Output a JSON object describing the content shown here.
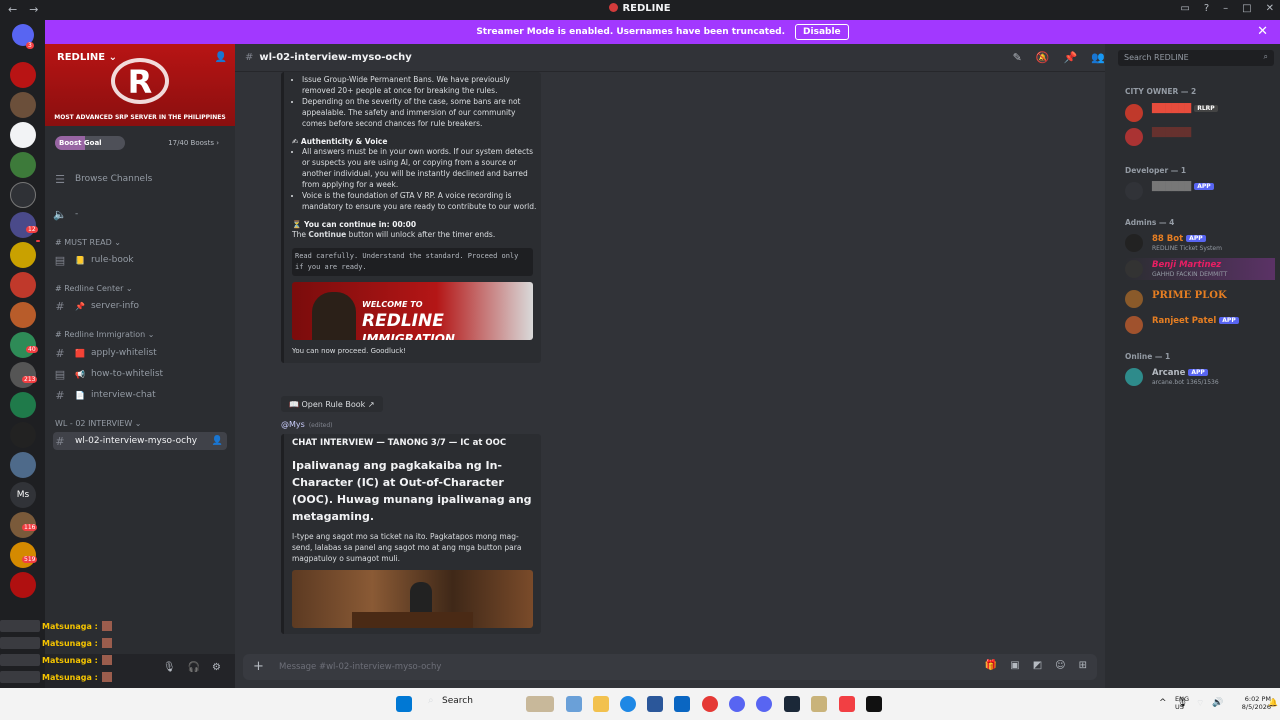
{
  "window": {
    "title": "REDLINE",
    "nav_back": "←",
    "nav_forward": "→"
  },
  "streamer_banner": {
    "text": "Streamer Mode is enabled. Usernames have been truncated.",
    "button": "Disable",
    "close": "✕"
  },
  "server": {
    "name": "REDLINE",
    "tagline": "MOST ADVANCED SRP SERVER IN THE PHILIPPINES",
    "logo_letter": "R",
    "boost_label": "Boost Goal",
    "boost_count": "17/40 Boosts",
    "boost_progress": 0.425
  },
  "server_badges": [
    "3",
    "12",
    "40",
    "213",
    "116",
    "519"
  ],
  "sidebar": {
    "browse": "Browse Channels",
    "voice_placeholder": "-",
    "categories": [
      {
        "label": "# MUST READ",
        "channels": [
          {
            "label": "rule-book"
          }
        ]
      },
      {
        "label": "# Redline Center",
        "channels": [
          {
            "label": "server-info"
          }
        ]
      },
      {
        "label": "# Redline Immigration",
        "channels": [
          {
            "label": "apply-whitelist"
          },
          {
            "label": "how-to-whitelist"
          },
          {
            "label": "interview-chat"
          }
        ]
      },
      {
        "label": "WL - 02 INTERVIEW",
        "channels": [
          {
            "label": "wl-02-interview-myso-ochy"
          }
        ]
      }
    ]
  },
  "overlay_chat": {
    "name": "Matsunaga :"
  },
  "channel_header": {
    "name": "wl-02-interview-myso-ochy"
  },
  "message": {
    "intro_lines": [
      "Issue Group-Wide Permanent Bans. We have previously removed 20+ people at once for breaking the rules.",
      "Depending on the severity of the case, some bans are not appealable. The safety and immersion of our community comes before second chances for rule breakers."
    ],
    "auth_title": "✍ Authenticity & Voice",
    "auth_lines": [
      "All answers must be in your own words. If our system detects or suspects you are using AI, or copying from a source or another individual, you will be instantly declined and barred from applying for a week.",
      "Voice is the foundation of GTA V RP. A voice recording is mandatory to ensure you are ready to contribute to our world."
    ],
    "timer": "⏳ You can continue in: 00:00",
    "continue_pre": "The ",
    "continue_bold": "Continue",
    "continue_post": " button will unlock after the timer ends.",
    "code": "Read carefully. Understand the standard. Proceed only if you are ready.",
    "image_text_1": "WELCOME TO",
    "image_text_2": "REDLINE",
    "image_text_3": "IMMIGRATION",
    "proceed": "You can now proceed. Goodluck!",
    "button": "📖 Open Rule Book ↗",
    "mention": "@Mys",
    "edited": "(edited)",
    "q_header": "CHAT INTERVIEW — TANONG 3/7 — IC at OOC",
    "q_title": "Ipaliwanag ang pagkakaiba ng In-Character (IC) at Out-of-Character (OOC). Huwag munang ipaliwanag ang metagaming.",
    "q_body": "I-type ang sagot mo sa ticket na ito. Pagkatapos mong mag-send, lalabas sa panel ang sagot mo at ang mga button para magpatuloy o sumagot muli."
  },
  "input": {
    "placeholder": "Message #wl-02-interview-myso-ochy",
    "plus": "+"
  },
  "members": {
    "search": "Search REDLINE",
    "groups": [
      {
        "label": "CITY OWNER — 2"
      },
      {
        "label": "Developer — 1"
      },
      {
        "label": "Admins — 4"
      },
      {
        "label": "Online — 1"
      }
    ],
    "owner_tag": "RLRP",
    "admins": [
      {
        "name": "88 Bot",
        "badge": "APP",
        "sub": "REDLINE Ticket System",
        "color": "#e67e22"
      },
      {
        "name": "Benji Martinez",
        "sub": "GAHHD FACKIN DEMMITT",
        "color": "#e91e63"
      },
      {
        "name": "PRIME PLOK",
        "color": "#e67e22"
      },
      {
        "name": "Ranjeet Patel",
        "badge": "APP",
        "color": "#e67e22"
      }
    ],
    "online": [
      {
        "name": "Arcane",
        "badge": "APP",
        "sub": "arcane.bot 1365/1536",
        "color": "#b5bac1"
      }
    ],
    "dev_badge": "APP"
  },
  "taskbar": {
    "search": "Search",
    "lang1": "ENG",
    "lang2": "US",
    "time": "6:02 PM",
    "date": "8/5/2026"
  },
  "colors": {
    "accent": "#a238ff",
    "brand": "#b81414",
    "blurple": "#5865f2"
  }
}
